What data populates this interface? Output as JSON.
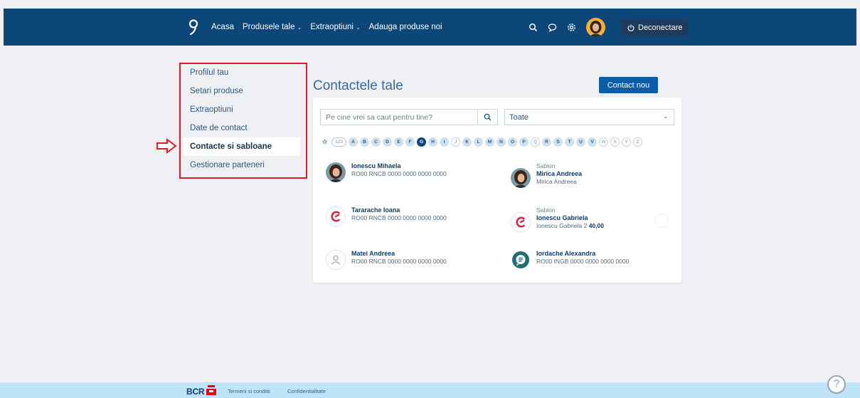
{
  "nav": {
    "items": [
      {
        "label": "Acasa",
        "caret": false
      },
      {
        "label": "Produsele tale",
        "caret": true
      },
      {
        "label": "Extraoptiuni",
        "caret": true
      },
      {
        "label": "Adauga produse noi",
        "caret": false
      }
    ],
    "logout_label": "Deconectare",
    "icons": [
      "search-icon",
      "chat-icon",
      "gear-icon",
      "avatar"
    ]
  },
  "sidebar": {
    "items": [
      {
        "label": "Profilul tau",
        "active": false
      },
      {
        "label": "Setari produse",
        "active": false
      },
      {
        "label": "Extraoptiuni",
        "active": false
      },
      {
        "label": "Date de contact",
        "active": false
      },
      {
        "label": "Contacte si sabloane",
        "active": true
      },
      {
        "label": "Gestionare parteneri",
        "active": false
      }
    ]
  },
  "main": {
    "title": "Contactele tale",
    "new_contact_label": "Contact nou",
    "search_placeholder": "Pe cine vrei sa caut pentru tine?",
    "filter_value": "Toate",
    "alphabet": {
      "numeric_label": "123",
      "letters": [
        {
          "l": "A",
          "s": "on"
        },
        {
          "l": "B",
          "s": "on"
        },
        {
          "l": "C",
          "s": "on"
        },
        {
          "l": "D",
          "s": "on"
        },
        {
          "l": "E",
          "s": "on"
        },
        {
          "l": "F",
          "s": "on"
        },
        {
          "l": "G",
          "s": "sel"
        },
        {
          "l": "H",
          "s": "on"
        },
        {
          "l": "I",
          "s": "on"
        },
        {
          "l": "J",
          "s": "off"
        },
        {
          "l": "K",
          "s": "on"
        },
        {
          "l": "L",
          "s": "on"
        },
        {
          "l": "M",
          "s": "on"
        },
        {
          "l": "N",
          "s": "on"
        },
        {
          "l": "O",
          "s": "on"
        },
        {
          "l": "P",
          "s": "on"
        },
        {
          "l": "Q",
          "s": "off"
        },
        {
          "l": "R",
          "s": "on"
        },
        {
          "l": "S",
          "s": "on"
        },
        {
          "l": "T",
          "s": "on"
        },
        {
          "l": "U",
          "s": "on"
        },
        {
          "l": "V",
          "s": "on"
        },
        {
          "l": "W",
          "s": "off"
        },
        {
          "l": "X",
          "s": "off"
        },
        {
          "l": "Y",
          "s": "off"
        },
        {
          "l": "Z",
          "s": "off"
        }
      ]
    },
    "contacts": [
      {
        "avatar": "photo-woman",
        "label": "",
        "name": "Ionescu Mihaela",
        "sub": "RO00 RNCB 0000 0000 0000 0000",
        "amount": ""
      },
      {
        "avatar": "photo-woman",
        "label": "Sablon",
        "name": "Mirica Andreea",
        "sub": "Mirica Andreea",
        "amount": ""
      },
      {
        "avatar": "george-logo",
        "label": "",
        "name": "Tararache Ioana",
        "sub": "RO00 RNCB 0000 0000 0000 0000",
        "amount": ""
      },
      {
        "avatar": "george-logo",
        "label": "Sablon",
        "name": "Ionescu Gabriela",
        "sub": "Ionescu Gabriela 2",
        "amount": "40,00"
      },
      {
        "avatar": "person-outline",
        "label": "",
        "name": "Matei Andreea",
        "sub": "RO00 RNCB 0000 0000 0000 0000",
        "amount": ""
      },
      {
        "avatar": "bank-chat-logo",
        "label": "",
        "name": "Iordache Alexandra",
        "sub": "RO00 INGB 0000 0000 0000 0000",
        "amount": ""
      }
    ]
  },
  "footer": {
    "brand": "BCR",
    "links": [
      "Termeni si conditii",
      "Confidentialitate"
    ],
    "help_label": "?"
  },
  "colors": {
    "nav_bg": "#0d4678",
    "accent_button": "#0e5ca5",
    "highlight_red": "#e01b24",
    "footer_bg": "#bfe3f8",
    "george_red": "#d6254d"
  }
}
